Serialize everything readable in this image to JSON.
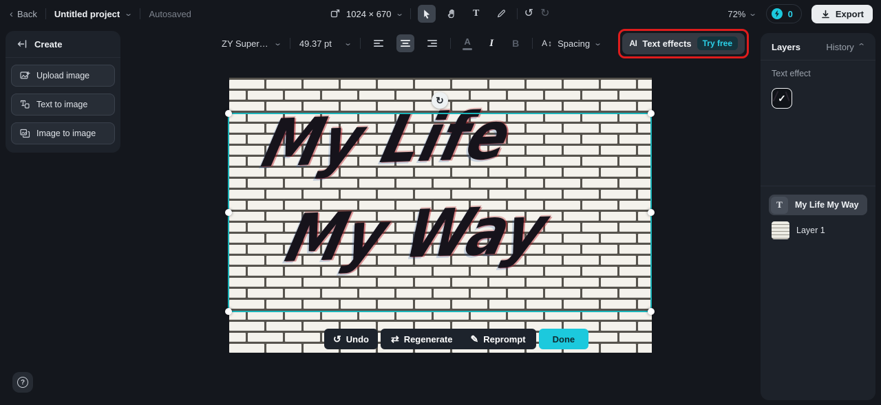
{
  "topbar": {
    "back_label": "Back",
    "project_name": "Untitled project",
    "autosave_status": "Autosaved",
    "canvas_size": "1024 × 670",
    "zoom_level": "72%",
    "credits_count": "0",
    "export_label": "Export"
  },
  "toolbar": {
    "font_name": "ZY Super…",
    "font_size": "49.37 pt",
    "color_glyph": "A",
    "italic_glyph": "I",
    "bold_glyph": "B",
    "spacing_icon_glyph": "A↕",
    "spacing_label": "Spacing",
    "ai_glyph": "AI",
    "text_effects_label": "Text effects",
    "try_free_label": "Try free"
  },
  "create_panel": {
    "title": "Create",
    "items": [
      {
        "label": "Upload image"
      },
      {
        "label": "Text to image"
      },
      {
        "label": "Image to image"
      }
    ]
  },
  "canvas": {
    "graffiti_line1": "My Life",
    "graffiti_line2": "My Way",
    "actions": {
      "undo": "Undo",
      "regenerate": "Regenerate",
      "reprompt": "Reprompt",
      "done": "Done"
    }
  },
  "layers_panel": {
    "title": "Layers",
    "history_label": "History",
    "section_label": "Text effect",
    "layers": [
      {
        "name": "My Life My Way",
        "type": "text"
      },
      {
        "name": "Layer 1",
        "type": "image"
      }
    ],
    "text_icon_glyph": "T"
  },
  "icons": {
    "back_chevron": "‹",
    "chevron_down": "⌄",
    "chevron_up": "⌃",
    "undo_glyph": "↺",
    "redo_glyph": "↻",
    "rotate_glyph": "↻",
    "regenerate_glyph": "⇄",
    "reprompt_glyph": "✎",
    "check_glyph": "✓",
    "help_glyph": "?",
    "text_tool_glyph": "T"
  },
  "colors": {
    "accent_cyan": "#1cc9dd",
    "selection_teal": "#1cb5ba",
    "annotation_red": "#de1c1c",
    "panel_bg": "#1d222a",
    "app_bg": "#14171d"
  }
}
